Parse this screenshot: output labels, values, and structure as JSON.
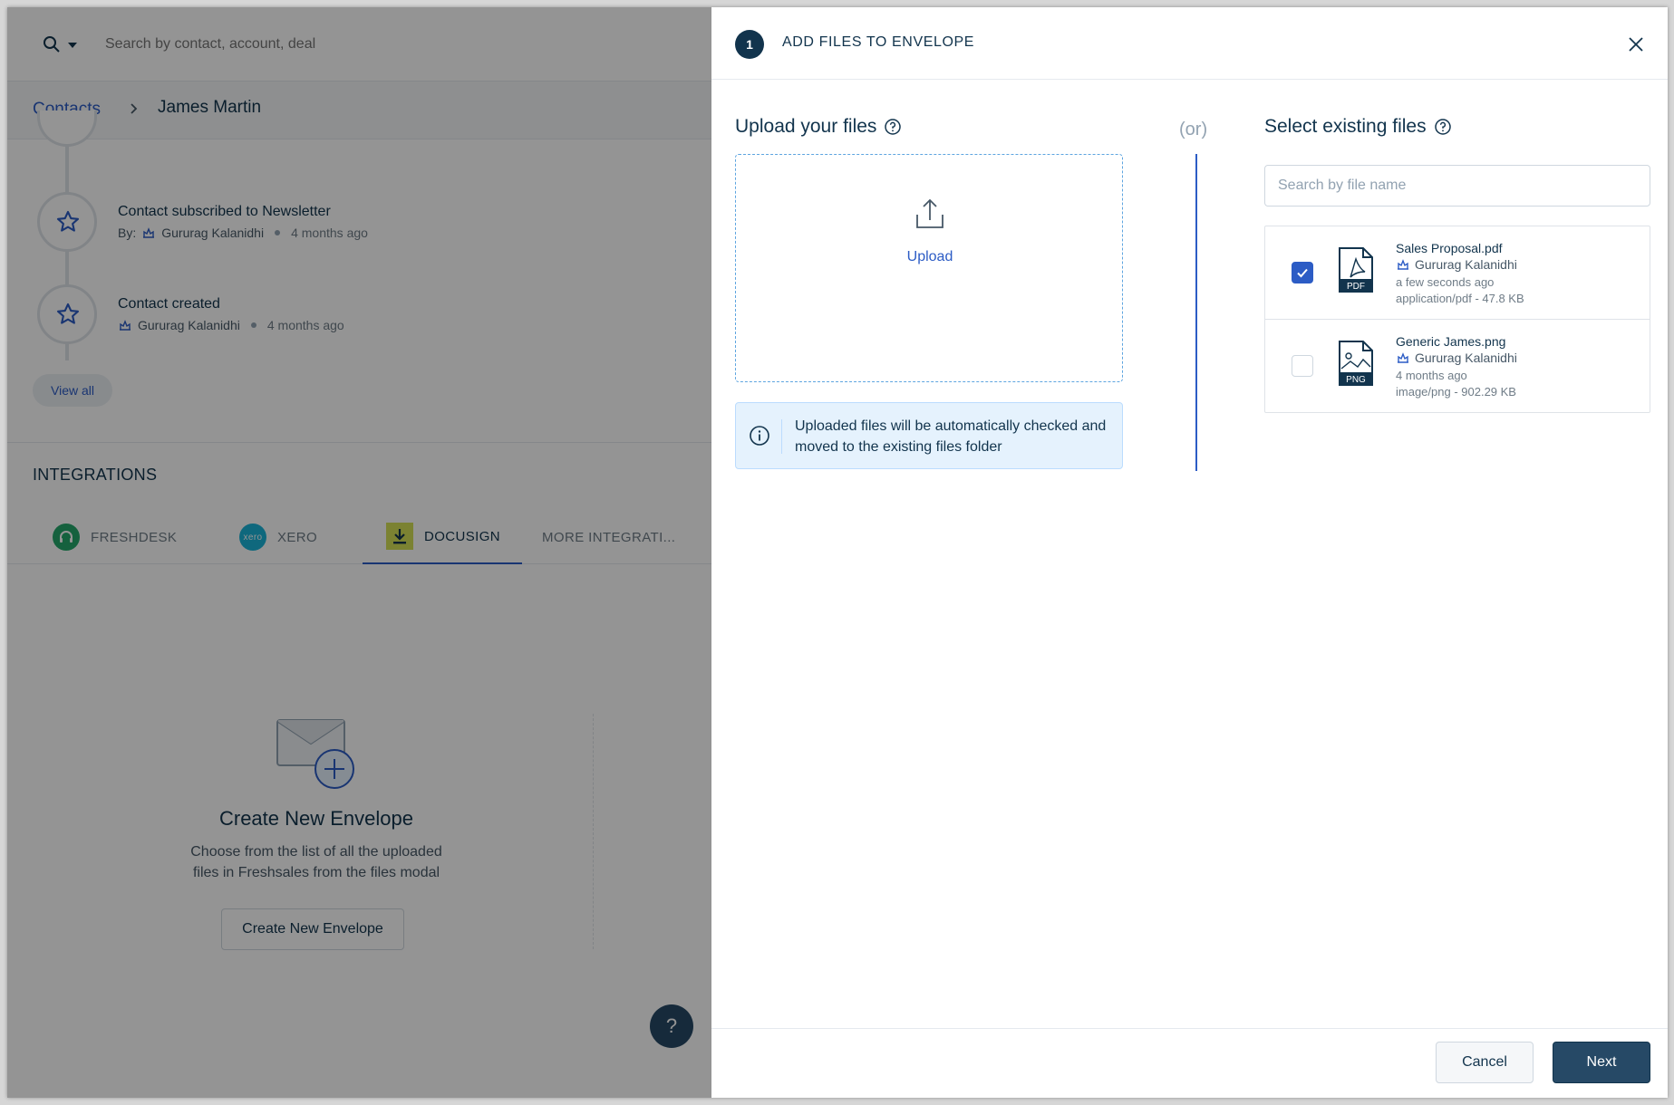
{
  "search": {
    "placeholder": "Search by contact, account, deal"
  },
  "breadcrumb": {
    "parent": "Contacts",
    "current": "James Martin"
  },
  "timeline": {
    "items": [
      {
        "title": "Contact subscribed to Newsletter",
        "prefix": "By:",
        "user": "Gururag Kalanidhi",
        "time": "4 months ago",
        "icon": "star-icon"
      },
      {
        "title": "Contact created",
        "prefix": "",
        "user": "Gururag Kalanidhi",
        "time": "4 months ago",
        "icon": "star-icon"
      }
    ],
    "view_all": "View all"
  },
  "integrations": {
    "title": "INTEGRATIONS",
    "tabs": [
      {
        "label": "FRESHDESK",
        "icon": "freshdesk-logo"
      },
      {
        "label": "XERO",
        "icon": "xero-logo"
      },
      {
        "label": "DOCUSIGN",
        "icon": "docusign-logo",
        "active": true
      },
      {
        "label": "MORE INTEGRATI..."
      }
    ],
    "xero_logo_text": "xero"
  },
  "envelope": {
    "title": "Create New Envelope",
    "description": "Choose from the list of all the uploaded files in Freshsales from the files modal",
    "button": "Create New Envelope"
  },
  "help_fab": "?",
  "modal": {
    "step": "1",
    "title": "ADD FILES TO ENVELOPE",
    "upload": {
      "heading": "Upload your files",
      "link": "Upload",
      "info": "Uploaded files will be automatically checked and moved to the existing files folder"
    },
    "or_label": "(or)",
    "existing": {
      "heading": "Select existing files",
      "search_placeholder": "Search by file name",
      "files": [
        {
          "name": "Sales Proposal.pdf",
          "owner": "Gururag Kalanidhi",
          "time": "a few seconds ago",
          "meta": "application/pdf - 47.8 KB",
          "checked": true,
          "type_badge": "PDF"
        },
        {
          "name": "Generic James.png",
          "owner": "Gururag Kalanidhi",
          "time": "4 months ago",
          "meta": "image/png - 902.29 KB",
          "checked": false,
          "type_badge": "PNG"
        }
      ]
    },
    "footer": {
      "cancel": "Cancel",
      "next": "Next"
    }
  },
  "colors": {
    "primary": "#2c5cc5",
    "dark": "#12344d",
    "next_button": "#264966",
    "info_bg": "#e5f2fd"
  }
}
